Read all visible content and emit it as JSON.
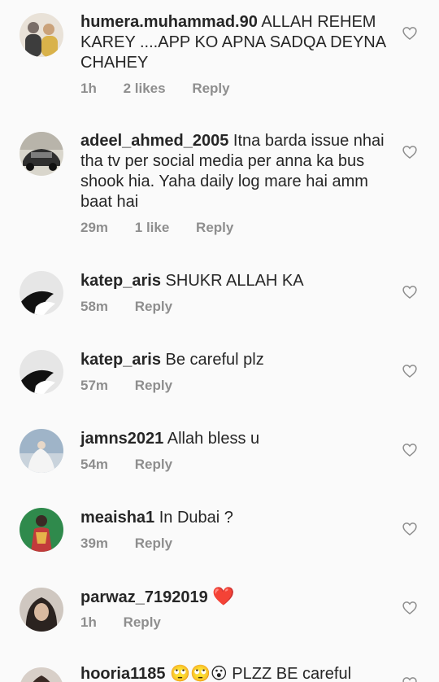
{
  "comments": [
    {
      "username": "humera.muhammad.90",
      "text": "ALLAH REHEM KAREY ....APP KO APNA SADQA DEYNA CHAHEY",
      "time": "1h",
      "likes": "2 likes",
      "reply": "Reply",
      "avatar_colors": [
        "#6b6b6b",
        "#caa27a"
      ]
    },
    {
      "username": "adeel_ahmed_2005",
      "text": "Itna barda issue nhai tha tv per social media per anna ka bus shook hia. Yaha daily log mare hai amm baat hai",
      "time": "29m",
      "likes": "1 like",
      "reply": "Reply",
      "avatar_colors": [
        "#d9d6cc",
        "#3a3a3a"
      ]
    },
    {
      "username": "katep_aris",
      "text": "SHUKR ALLAH KA",
      "time": "58m",
      "reply": "Reply",
      "avatar_colors": [
        "#e6e6e6",
        "#111111"
      ]
    },
    {
      "username": "katep_aris",
      "text": "Be careful plz",
      "time": "57m",
      "reply": "Reply",
      "avatar_colors": [
        "#e6e6e6",
        "#111111"
      ]
    },
    {
      "username": "jamns2021",
      "text": "Allah bless u",
      "time": "54m",
      "reply": "Reply",
      "avatar_colors": [
        "#9fb4c8",
        "#f2f2f2"
      ]
    },
    {
      "username": "meaisha1",
      "text": "In Dubai ?",
      "time": "39m",
      "reply": "Reply",
      "avatar_colors": [
        "#2f8a4c",
        "#c23b3b"
      ]
    },
    {
      "username": "parwaz_7192019",
      "text": "❤️",
      "time": "1h",
      "reply": "Reply",
      "avatar_colors": [
        "#cfc7c0",
        "#2b2320"
      ]
    },
    {
      "username": "hooria1185",
      "text": "🙄🙄😮 PLZZ  BE careful",
      "avatar_colors": [
        "#d8cfc8",
        "#3a2a24"
      ]
    }
  ],
  "icons": {
    "like": "heart-outline-icon",
    "liked_emoji_color": "#ed4956"
  }
}
